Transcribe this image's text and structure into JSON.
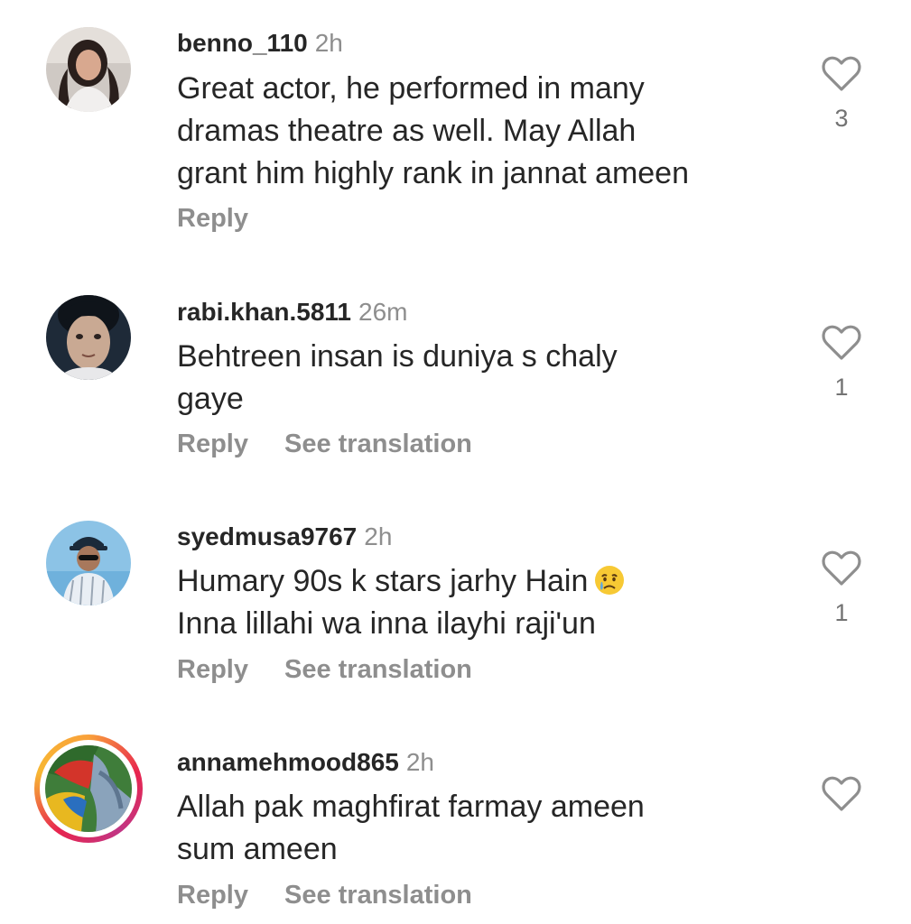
{
  "comments": [
    {
      "username": "benno_110",
      "time": "2h",
      "lines": [
        "Great actor, he performed in many",
        "dramas theatre as well. May Allah",
        "grant him highly rank in jannat ameen"
      ],
      "reply_label": "Reply",
      "translation_label": "",
      "likes": "3",
      "avatar_icon": "woman-portrait-avatar"
    },
    {
      "username": "rabi.khan.5811",
      "time": "26m",
      "lines": [
        "Behtreen insan is duniya s chaly",
        "gaye"
      ],
      "reply_label": "Reply",
      "translation_label": "See translation",
      "likes": "1",
      "avatar_icon": "child-portrait-avatar"
    },
    {
      "username": "syedmusa9767",
      "time": "2h",
      "lines": [
        "Humary 90s k stars jarhy Hain",
        "Inna lillahi wa inna ilayhi raji'un"
      ],
      "emoji": "crying-face-emoji",
      "reply_label": "Reply",
      "translation_label": "See translation",
      "likes": "1",
      "avatar_icon": "man-cap-avatar"
    },
    {
      "username": "annamehmood865",
      "time": "2h",
      "lines": [
        "Allah pak maghfirat farmay ameen",
        "sum ameen"
      ],
      "reply_label": "Reply",
      "translation_label": "See translation",
      "likes": "",
      "avatar_icon": "colorful-story-avatar"
    }
  ],
  "colors": {
    "username": "#262626",
    "secondary": "#8e8e8e",
    "story_ring": "#e7254f"
  }
}
